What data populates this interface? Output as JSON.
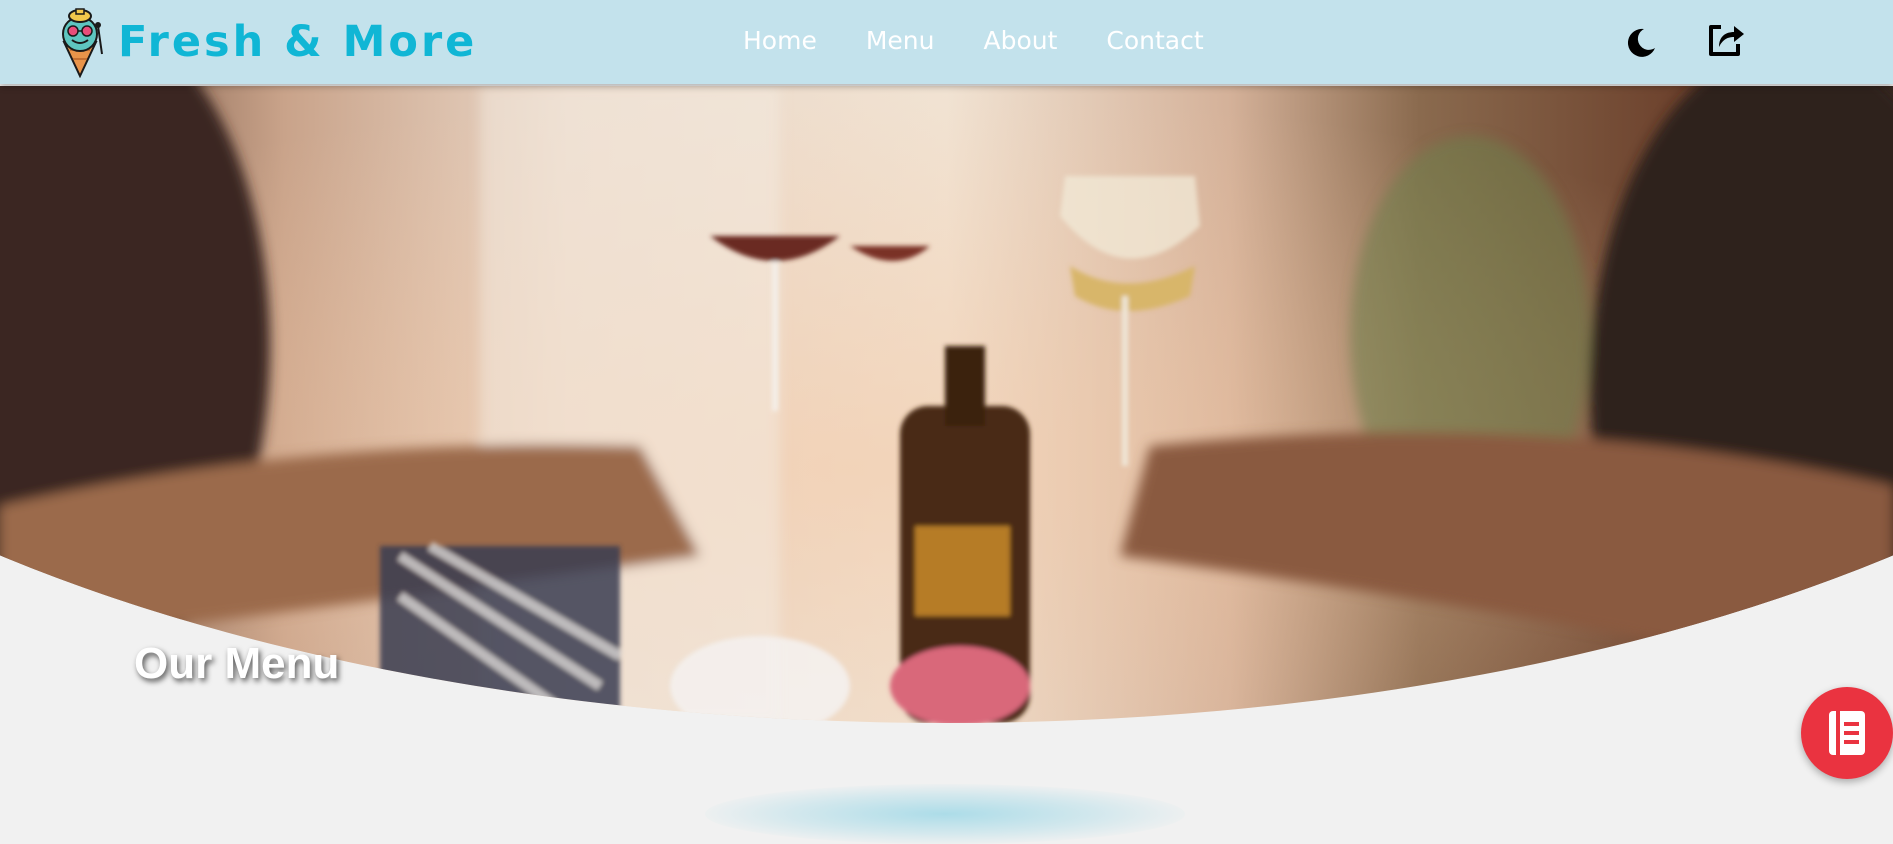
{
  "brand": {
    "name": "Fresh & More"
  },
  "nav": {
    "items": [
      "Home",
      "Menu",
      "About",
      "Contact"
    ]
  },
  "header_actions": {
    "theme_icon": "moon-icon",
    "share_icon": "share-icon"
  },
  "hero": {
    "title": "Our Menu",
    "image_subject": "people toasting with wine glasses"
  },
  "fab": {
    "icon": "menu-book-icon",
    "color": "#ea3340"
  },
  "colors": {
    "brand": "#10b6d5",
    "navbar_bg": "#c3e2ec",
    "page_bg": "#f1f1f1"
  }
}
